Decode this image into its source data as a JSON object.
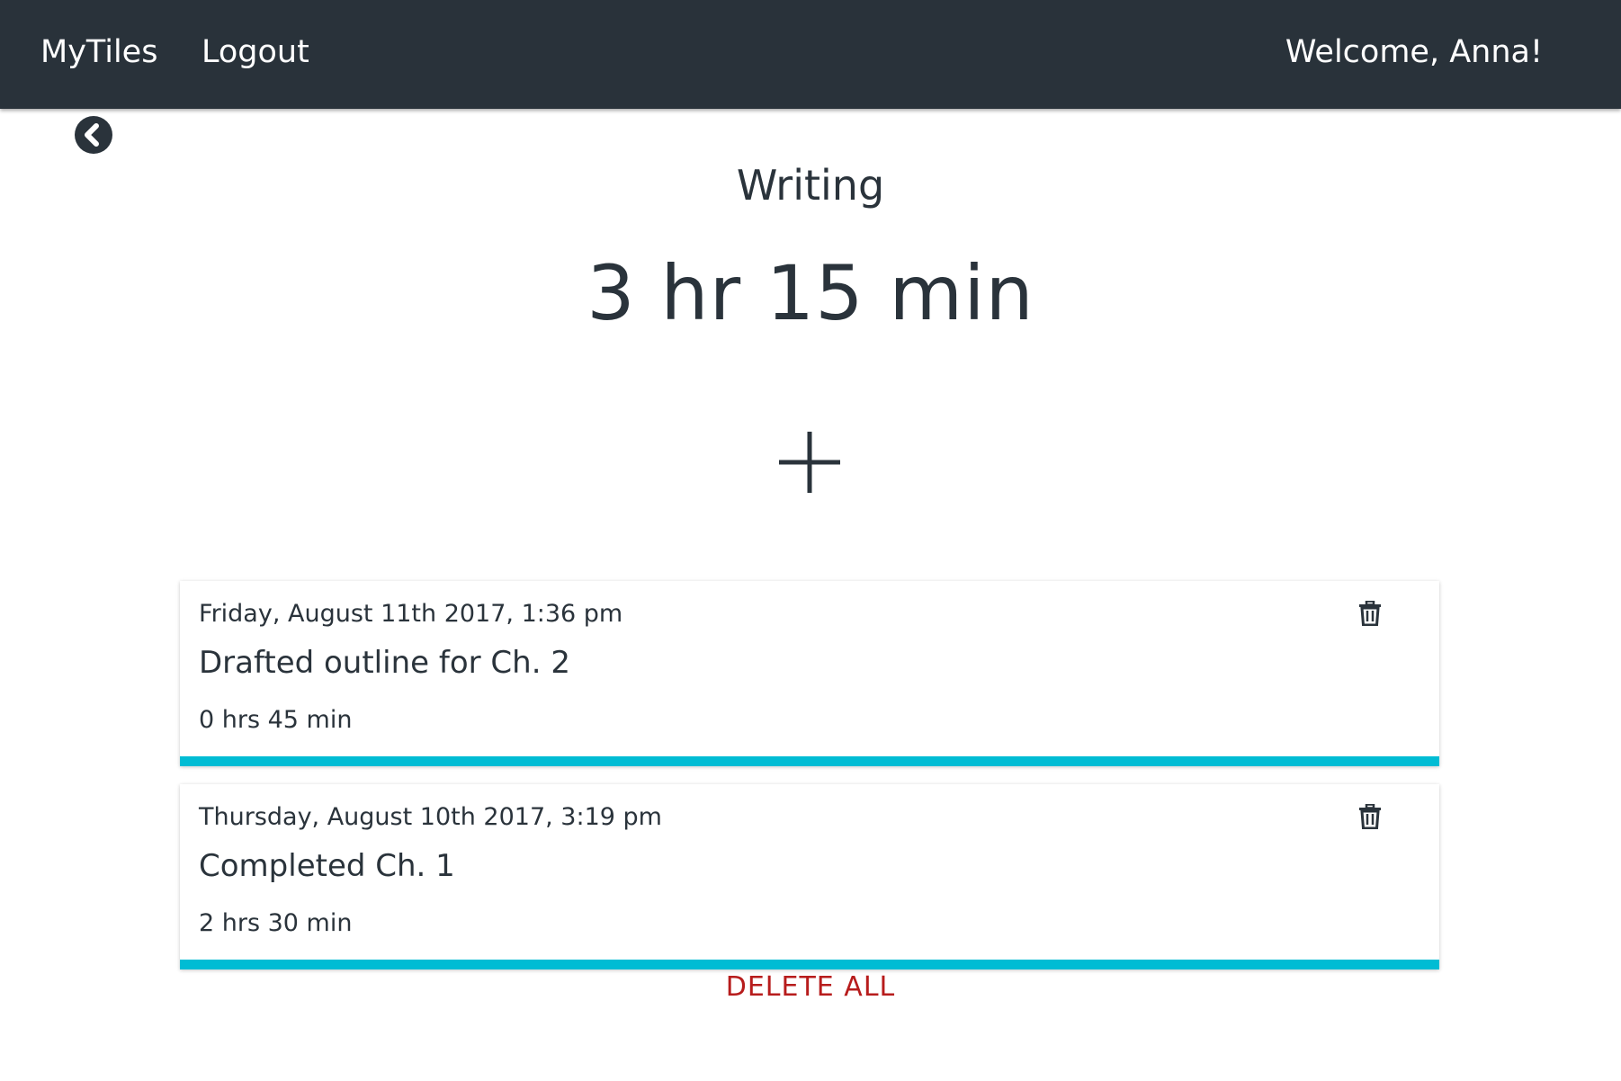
{
  "navbar": {
    "brand": "MyTiles",
    "logout": "Logout",
    "welcome": "Welcome, Anna!"
  },
  "page": {
    "title": "Writing",
    "total_time": "3 hr 15 min"
  },
  "entries": [
    {
      "date": "Friday, August 11th 2017, 1:36 pm",
      "description": "Drafted outline for Ch. 2",
      "duration": "0 hrs 45 min"
    },
    {
      "date": "Thursday, August 10th 2017, 3:19 pm",
      "description": "Completed Ch. 1",
      "duration": "2 hrs 30 min"
    }
  ],
  "actions": {
    "delete_all": "DELETE ALL"
  },
  "icons": {
    "back": "chevron-left-circle-icon",
    "add": "plus-icon",
    "delete": "trash-icon"
  },
  "colors": {
    "navbar_bg": "#29323a",
    "accent": "#00bcd4",
    "danger": "#b71c1c",
    "text": "#2a333b"
  }
}
